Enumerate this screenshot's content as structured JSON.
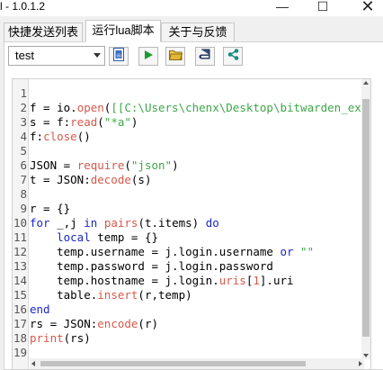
{
  "window": {
    "title": "l - 1.0.1.2",
    "minimize_glyph": "—",
    "maximize_glyph": "☐",
    "close_glyph": "✕"
  },
  "tabs": [
    {
      "label": "快捷发送列表",
      "active": false
    },
    {
      "label": "运行lua脚本",
      "active": true
    },
    {
      "label": "关于与反馈",
      "active": false
    }
  ],
  "toolbar": {
    "script_select_value": "test",
    "buttons": [
      {
        "icon": "script-icon"
      },
      {
        "icon": "run-icon"
      },
      {
        "icon": "folder-icon"
      },
      {
        "icon": "book-icon"
      },
      {
        "icon": "share-icon"
      }
    ]
  },
  "colors": {
    "keyword": "#1b27c2",
    "function": "#d7584a",
    "string": "#3ca848",
    "run_green": "#1d9a2d",
    "folder_yellow": "#e4b634",
    "share_teal": "#1c8a86"
  },
  "editor": {
    "line_numbers": [
      "1",
      "2",
      "3",
      "4",
      "5",
      "6",
      "7",
      "8",
      "9",
      "10",
      "11",
      "12",
      "13",
      "14",
      "15",
      "16",
      "17",
      "18",
      "19"
    ],
    "lines": [
      [],
      [
        {
          "t": "f = io."
        },
        {
          "t": "open",
          "c": "fn"
        },
        {
          "t": "("
        },
        {
          "t": "[[C:\\Users\\chenx\\Desktop\\bitwarden_ex",
          "c": "str"
        }
      ],
      [
        {
          "t": "s = f:"
        },
        {
          "t": "read",
          "c": "fn"
        },
        {
          "t": "("
        },
        {
          "t": "\"*a\"",
          "c": "str"
        },
        {
          "t": ")"
        }
      ],
      [
        {
          "t": "f:"
        },
        {
          "t": "close",
          "c": "fn"
        },
        {
          "t": "()"
        }
      ],
      [],
      [
        {
          "t": "JSON = "
        },
        {
          "t": "require",
          "c": "fn"
        },
        {
          "t": "("
        },
        {
          "t": "\"json\"",
          "c": "str"
        },
        {
          "t": ")"
        }
      ],
      [
        {
          "t": "t = JSON:"
        },
        {
          "t": "decode",
          "c": "fn"
        },
        {
          "t": "(s)"
        }
      ],
      [],
      [
        {
          "t": "r = {}"
        }
      ],
      [
        {
          "t": "for",
          "c": "kw"
        },
        {
          "t": " _,j "
        },
        {
          "t": "in",
          "c": "kw"
        },
        {
          "t": " "
        },
        {
          "t": "pairs",
          "c": "fn"
        },
        {
          "t": "(t.items) "
        },
        {
          "t": "do",
          "c": "kw"
        }
      ],
      [
        {
          "t": "    "
        },
        {
          "t": "local",
          "c": "kw"
        },
        {
          "t": " temp = {}"
        }
      ],
      [
        {
          "t": "    temp.username = j.login.username "
        },
        {
          "t": "or",
          "c": "kw"
        },
        {
          "t": " "
        },
        {
          "t": "\"\"",
          "c": "str"
        }
      ],
      [
        {
          "t": "    temp.password = j.login.password"
        }
      ],
      [
        {
          "t": "    temp.hostname = j.login."
        },
        {
          "t": "uris",
          "c": "fn"
        },
        {
          "t": "["
        },
        {
          "t": "1",
          "c": "fn"
        },
        {
          "t": "].uri"
        }
      ],
      [
        {
          "t": "    table."
        },
        {
          "t": "insert",
          "c": "fn"
        },
        {
          "t": "(r,temp)"
        }
      ],
      [
        {
          "t": "end",
          "c": "kw"
        }
      ],
      [
        {
          "t": "rs = JSON:"
        },
        {
          "t": "encode",
          "c": "fn"
        },
        {
          "t": "(r)"
        }
      ],
      [
        {
          "t": "print",
          "c": "fn"
        },
        {
          "t": "(rs)"
        }
      ],
      []
    ]
  }
}
